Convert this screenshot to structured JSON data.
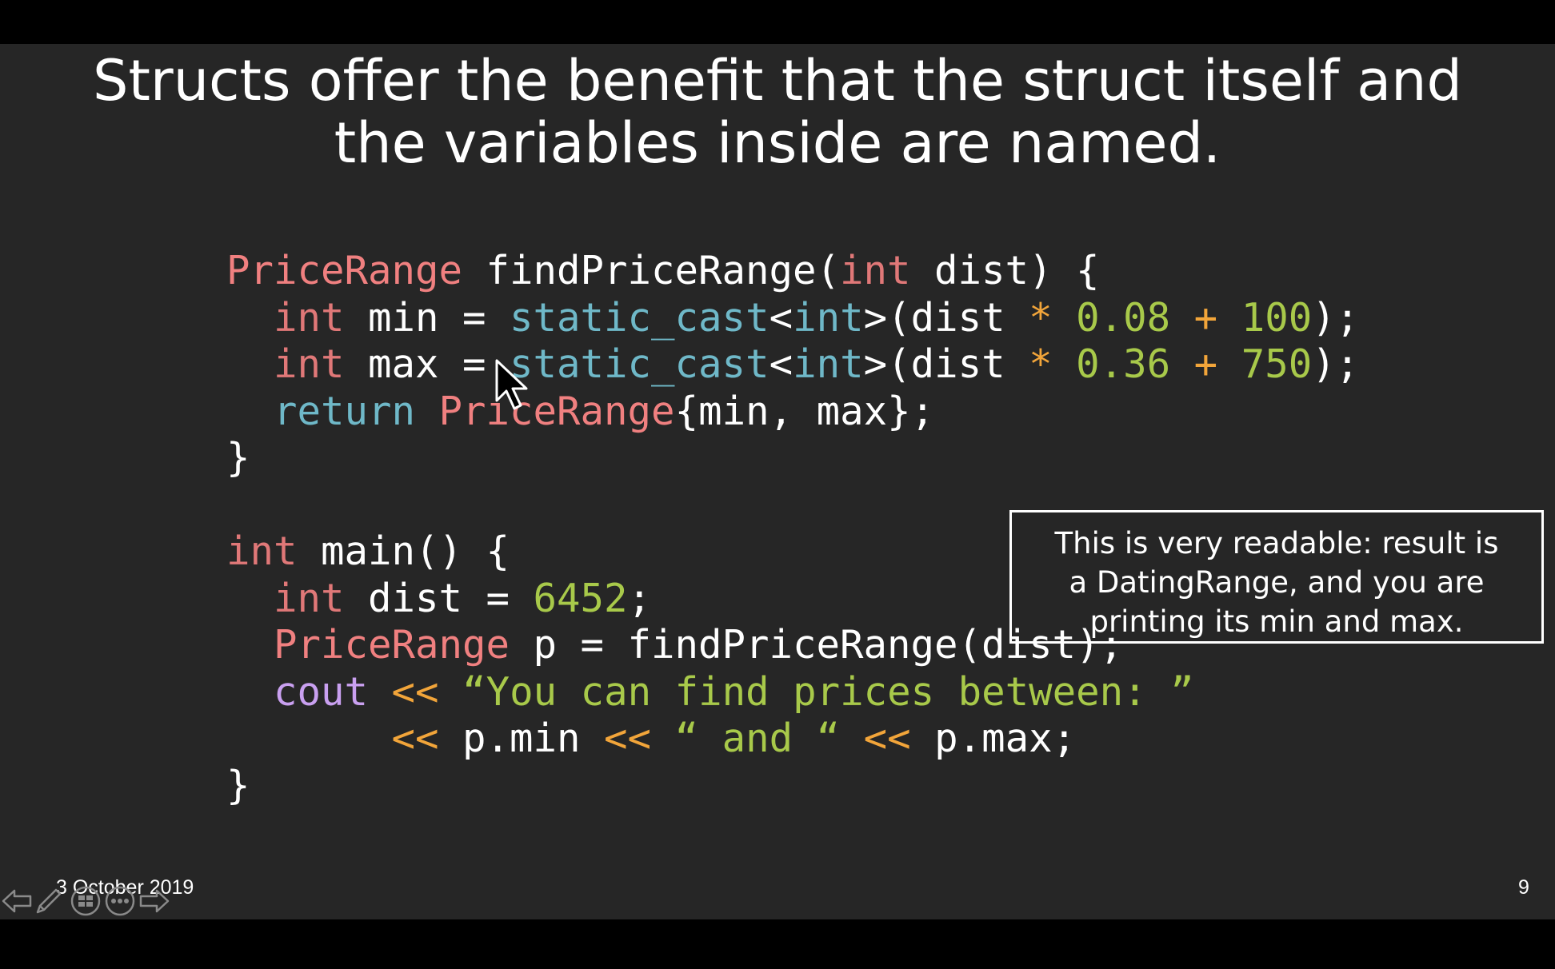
{
  "slide": {
    "title_lines": [
      "Structs offer the benefit that the struct itself and",
      "the variables inside are named."
    ],
    "code": {
      "l1": {
        "type": "PriceRange",
        "fn_head": " findPriceRange(",
        "kw": "int",
        "rest": " dist) {"
      },
      "l2": {
        "kw": "int",
        "a": " min = ",
        "cast": "static_cast",
        "lt": "<",
        "castkw": "int",
        "b": ">(dist ",
        "op1": "*",
        "n1": "0.08",
        "op2": "+",
        "n2": "100",
        "end": ");"
      },
      "l3": {
        "kw": "int",
        "a": " max = ",
        "cast": "static_cast",
        "lt": "<",
        "castkw": "int",
        "b": ">(dist ",
        "op1": "*",
        "n1": "0.36",
        "op2": "+",
        "n2": "750",
        "end": ");"
      },
      "l4": {
        "ret": "return",
        "type": "PriceRange",
        "rest": "{min, max};"
      },
      "l5": {
        "text": "}"
      },
      "l7": {
        "kw": "int",
        "rest": " main() {"
      },
      "l8": {
        "kw": "int",
        "a": " dist = ",
        "n": "6452",
        "end": ";"
      },
      "l9": {
        "type": "PriceRange",
        "rest": " p = findPriceRange(dist);"
      },
      "l10": {
        "cout": "cout",
        "op": "<<",
        "str": "“You can find prices between: ”"
      },
      "l11": {
        "op1": "<<",
        "a": " p.min ",
        "op2": "<<",
        "str": "“ and “",
        "op3": "<<",
        "b": " p.max;"
      },
      "l12": {
        "text": "}"
      }
    },
    "callout_lines": [
      "This is very readable: result is",
      "a DatingRange, and you are",
      "printing its min and max."
    ],
    "footer": {
      "date": "3 October 2019",
      "page_number": "9"
    }
  },
  "controls": {
    "icons": [
      "previous-slide-icon",
      "pen-icon",
      "slides-grid-icon",
      "more-options-icon",
      "next-slide-icon"
    ]
  },
  "colors": {
    "background": "#262626",
    "type": "#f08080",
    "keyword": "#e07878",
    "function": "#6fb8c8",
    "cout": "#c9a0f0",
    "operator": "#f2a53a",
    "number_string": "#a8c94a"
  }
}
